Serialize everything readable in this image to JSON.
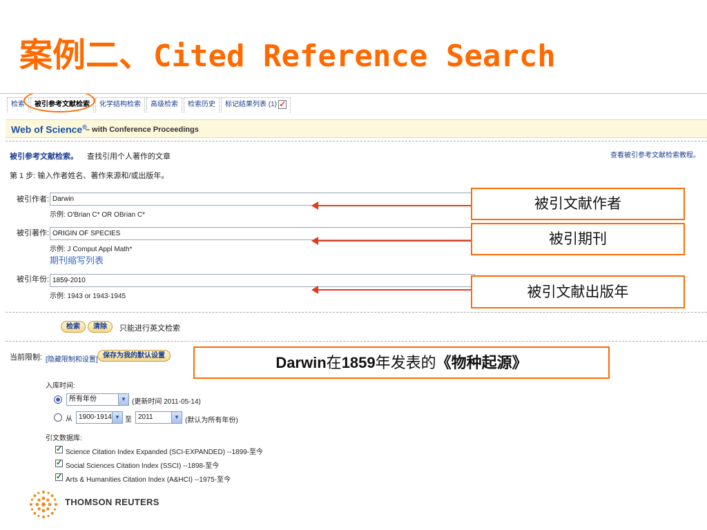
{
  "slide_title": {
    "cn": "案例二、",
    "en": "Cited Reference Search"
  },
  "tabs": [
    {
      "label": "检索"
    },
    {
      "label": "被引参考文献检索",
      "active": true
    },
    {
      "label": "化学结构检索"
    },
    {
      "label": "高级检索"
    },
    {
      "label": "检索历史"
    },
    {
      "label": "标记结果列表 (1)"
    }
  ],
  "wos": {
    "logo": "Web of Science",
    "reg": "®",
    "subtitle": "– with Conference Proceedings"
  },
  "page": {
    "heading": "被引参考文献检索。",
    "heading_desc": "查找引用个人著作的文章",
    "tutorial_link": "查看被引参考文献检索教程。",
    "step": "第 1 步: 输入作者姓名、著作来源和/或出版年。"
  },
  "fields": {
    "author": {
      "label": "被引作者:",
      "value": "Darwin",
      "example": "示例: O'Brian C* OR OBrian C*"
    },
    "work": {
      "label": "被引著作:",
      "value": "ORIGIN OF SPECIES",
      "example": "示例: J Comput Appl Math*",
      "abbrev_link": "期刊缩写列表"
    },
    "year": {
      "label": "被引年份:",
      "value": "1859-2010",
      "example": "示例: 1943 or 1943-1945"
    }
  },
  "actions": {
    "search": "检索",
    "clear": "清除",
    "note": "只能进行英文检索"
  },
  "limits": {
    "label": "当前限制:",
    "hide_link": "[隐藏限制和设置]",
    "save_default": "保存为我的默认设置",
    "timespan_label": "入库时间:",
    "all_years": "所有年份",
    "updated": "(更新时间 2011-05-14)",
    "from_label": "从",
    "from_value": "1900-1914",
    "to_label": "至",
    "to_value": "2011",
    "default_note": "(默认为所有年份)",
    "db_label": "引文数据库:",
    "databases": [
      "Science Citation Index Expanded (SCI-EXPANDED) --1899-至今",
      "Social Sciences Citation Index (SSCI) --1898-至今",
      "Arts & Humanities Citation Index (A&HCI) --1975-至今"
    ]
  },
  "callouts": {
    "author": "被引文献作者",
    "journal": "被引期刊",
    "year": "被引文献出版年"
  },
  "banner": {
    "p1": "Darwin",
    "p2": "在",
    "p3": "1859",
    "p4": "年发表的",
    "p5": "《物种起源》"
  },
  "footer": {
    "brand": "THOMSON REUTERS"
  },
  "colors": {
    "accent": "#ff6a00",
    "link": "#1a3d8f",
    "arrow": "#e03c1a"
  }
}
